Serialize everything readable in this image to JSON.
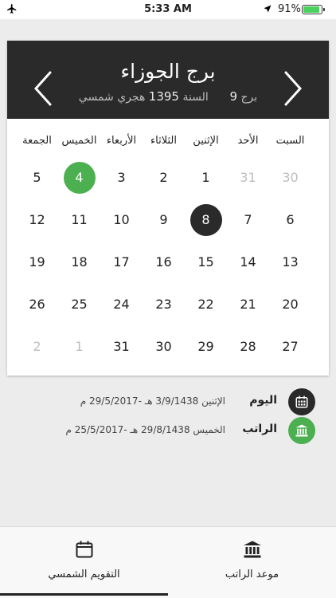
{
  "status": {
    "time": "5:33 AM",
    "battery": "91%",
    "battery_level": 0.91
  },
  "header": {
    "title": "برج الجوزاء",
    "sub_prefix": "برج",
    "sub_month_num": "9",
    "sub_year_word": "السنة",
    "sub_year": "1395",
    "sub_suffix": "هجري شمسي"
  },
  "weekdays": [
    "السبت",
    "الأحد",
    "الإثنين",
    "الثلاثاء",
    "الأربعاء",
    "الخميس",
    "الجمعة"
  ],
  "weeks": [
    [
      {
        "d": "30",
        "m": true
      },
      {
        "d": "31",
        "m": true
      },
      {
        "d": "1"
      },
      {
        "d": "2"
      },
      {
        "d": "3"
      },
      {
        "d": "4",
        "today": true
      },
      {
        "d": "5"
      }
    ],
    [
      {
        "d": "6"
      },
      {
        "d": "7"
      },
      {
        "d": "8",
        "selected": true
      },
      {
        "d": "9"
      },
      {
        "d": "10"
      },
      {
        "d": "11"
      },
      {
        "d": "12"
      }
    ],
    [
      {
        "d": "13"
      },
      {
        "d": "14"
      },
      {
        "d": "15"
      },
      {
        "d": "16"
      },
      {
        "d": "17"
      },
      {
        "d": "18"
      },
      {
        "d": "19"
      }
    ],
    [
      {
        "d": "20"
      },
      {
        "d": "21"
      },
      {
        "d": "22"
      },
      {
        "d": "23"
      },
      {
        "d": "24"
      },
      {
        "d": "25"
      },
      {
        "d": "26"
      }
    ],
    [
      {
        "d": "27"
      },
      {
        "d": "28"
      },
      {
        "d": "29"
      },
      {
        "d": "30"
      },
      {
        "d": "31"
      },
      {
        "d": "1",
        "m": true
      },
      {
        "d": "2",
        "m": true
      }
    ]
  ],
  "today_row": {
    "label": "اليوم",
    "value": "الإثنين 3/9/1438 هـ  -29/5/2017 م",
    "icon": "calendar-icon",
    "icon_color": "#2a2a2a"
  },
  "salary_row": {
    "label": "الراتب",
    "value": "الخميس 29/8/1438 هـ  -25/5/2017 م",
    "icon": "bank-icon",
    "icon_color": "#4caf50"
  },
  "tabs": {
    "left_label": "التقويم الشمسي",
    "left_icon": "calendar-icon",
    "right_label": "موعد الراتب",
    "right_icon": "bank-icon"
  },
  "colors": {
    "header_bg": "#2a2a2a",
    "today_green": "#4caf50",
    "selected_dark": "#2a2a2a"
  }
}
